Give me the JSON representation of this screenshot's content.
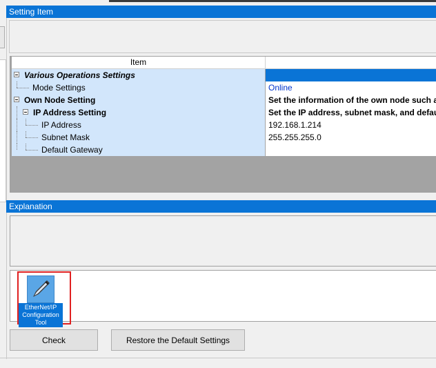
{
  "setting_section": {
    "title": "Setting Item"
  },
  "grid": {
    "column_item": "Item",
    "column_value": "",
    "rows": [
      {
        "label": "Various Operations Settings",
        "value": ""
      },
      {
        "label": "Mode Settings",
        "value": "Online"
      },
      {
        "label": "Own Node Setting",
        "value": "Set the information of the own node such as IP"
      },
      {
        "label": "IP Address Setting",
        "value": "Set the IP address, subnet mask, and default"
      },
      {
        "label": "IP Address",
        "value": "192.168.1.214"
      },
      {
        "label": "Subnet Mask",
        "value": "255.255.255.0"
      },
      {
        "label": "Default Gateway",
        "value": ""
      }
    ]
  },
  "explanation_section": {
    "title": "Explanation"
  },
  "tool": {
    "label": "EtherNet/IP Configuration Tool",
    "icon": "pencil-icon"
  },
  "buttons": {
    "check": "Check",
    "restore": "Restore the Default Settings"
  }
}
